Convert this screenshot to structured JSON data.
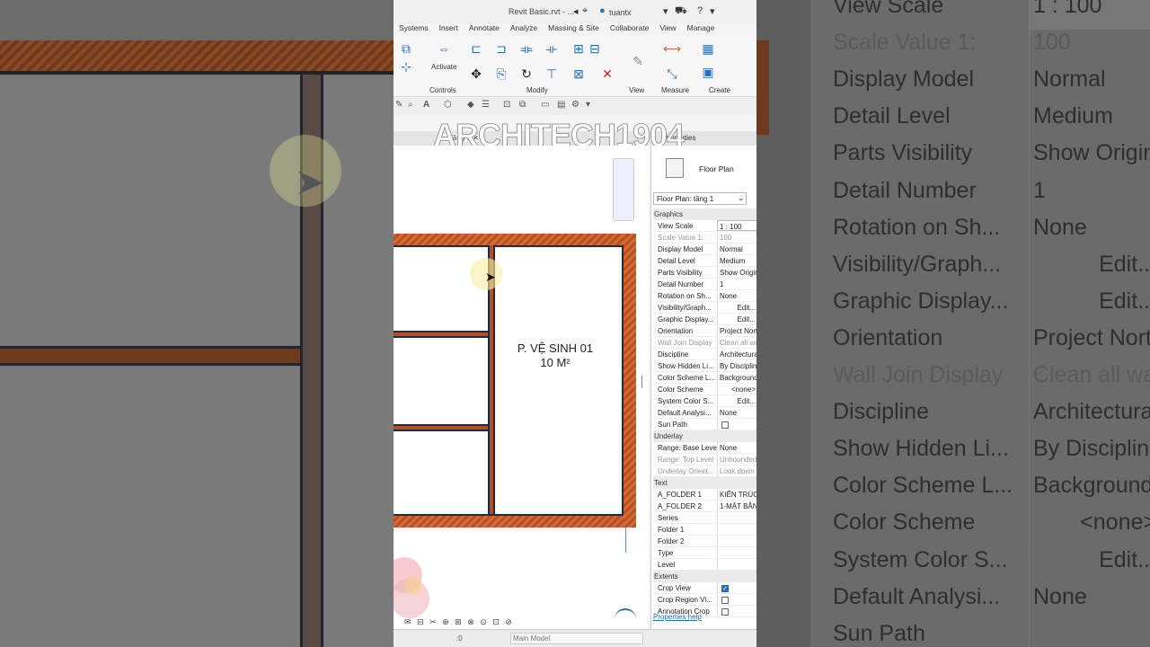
{
  "app": {
    "title": "Revit Basic.rvt - ...",
    "user": "tuantx",
    "tabs": [
      "Systems",
      "Insert",
      "Annotate",
      "Analyze",
      "Massing & Site",
      "Collaborate",
      "View",
      "Manage"
    ],
    "ribbon_groups": [
      "Controls",
      "Modify",
      "View",
      "Measure",
      "Create"
    ],
    "activate_label": "Activate",
    "view_tab": "Tầng 1",
    "properties_tab": "Properties",
    "watermark": "ARCHITECH1904"
  },
  "drawing": {
    "room_label_line1": "P. VỆ SINH 01",
    "room_label_line2": "10 M²"
  },
  "properties": {
    "type_name": "Floor Plan",
    "selector": "Floor Plan: tầng 1",
    "groups": [
      {
        "name": "Graphics",
        "rows": [
          {
            "k": "View Scale",
            "v": "1 : 100",
            "style": "box"
          },
          {
            "k": "Scale Value 1:",
            "v": "100",
            "style": "dim"
          },
          {
            "k": "Display Model",
            "v": "Normal"
          },
          {
            "k": "Detail Level",
            "v": "Medium"
          },
          {
            "k": "Parts Visibility",
            "v": "Show Original"
          },
          {
            "k": "Detail Number",
            "v": "1"
          },
          {
            "k": "Rotation on Sh...",
            "v": "None"
          },
          {
            "k": "Visibility/Graph...",
            "v": "Edit...",
            "style": "edit"
          },
          {
            "k": "Graphic Display...",
            "v": "Edit...",
            "style": "edit"
          },
          {
            "k": "Orientation",
            "v": "Project North"
          },
          {
            "k": "Wall Join Display",
            "v": "Clean all wall joins",
            "style": "dim"
          },
          {
            "k": "Discipline",
            "v": "Architectural"
          },
          {
            "k": "Show Hidden Li...",
            "v": "By Discipline"
          },
          {
            "k": "Color Scheme L...",
            "v": "Background"
          },
          {
            "k": "Color Scheme",
            "v": "<none>",
            "style": "edit"
          },
          {
            "k": "System Color S...",
            "v": "Edit...",
            "style": "edit"
          },
          {
            "k": "Default Analysi...",
            "v": "None"
          },
          {
            "k": "Sun Path",
            "v": "",
            "check": "off"
          }
        ]
      },
      {
        "name": "Underlay",
        "rows": [
          {
            "k": "Range: Base Level",
            "v": "None"
          },
          {
            "k": "Range: Top Level",
            "v": "Unbounded",
            "style": "dim"
          },
          {
            "k": "Underlay Orient...",
            "v": "Look down",
            "style": "dim"
          }
        ]
      },
      {
        "name": "Text",
        "rows": [
          {
            "k": "A_FOLDER 1",
            "v": "KIẾN TRÚC"
          },
          {
            "k": "A_FOLDER 2",
            "v": "1-MẶT BẰNG"
          },
          {
            "k": "Series",
            "v": ""
          },
          {
            "k": "Folder 1",
            "v": ""
          },
          {
            "k": "Folder 2",
            "v": ""
          },
          {
            "k": "Type",
            "v": ""
          },
          {
            "k": "Level",
            "v": ""
          }
        ]
      },
      {
        "name": "Extents",
        "rows": [
          {
            "k": "Crop View",
            "v": "",
            "check": "on"
          },
          {
            "k": "Crop Region Vi...",
            "v": "",
            "check": "off"
          },
          {
            "k": "Annotation Crop",
            "v": "",
            "check": "off"
          }
        ]
      }
    ],
    "help_link": "Properties help"
  },
  "status": {
    "count": ":0",
    "model": "Main Model"
  },
  "zoomed_rows": [
    {
      "k": "View Scale",
      "v": "1 : 100",
      "style": "box"
    },
    {
      "k": "Scale Value    1:",
      "v": "100",
      "style": "dim"
    },
    {
      "k": "Display Model",
      "v": "Normal"
    },
    {
      "k": "Detail Level",
      "v": "Medium"
    },
    {
      "k": "Parts Visibility",
      "v": "Show Original"
    },
    {
      "k": "Detail Number",
      "v": "1"
    },
    {
      "k": "Rotation on Sh...",
      "v": "None"
    },
    {
      "k": "Visibility/Graph...",
      "v": "Edit...",
      "style": "edit"
    },
    {
      "k": "Graphic Display...",
      "v": "Edit...",
      "style": "edit"
    },
    {
      "k": "Orientation",
      "v": "Project North"
    },
    {
      "k": "Wall Join Display",
      "v": "Clean all wall joins",
      "style": "dim"
    },
    {
      "k": "Discipline",
      "v": "Architectural"
    },
    {
      "k": "Show Hidden Li...",
      "v": "By Discipline"
    },
    {
      "k": "Color Scheme L...",
      "v": "Background"
    },
    {
      "k": "Color Scheme",
      "v": "<none>",
      "style": "edit"
    },
    {
      "k": "System Color S...",
      "v": "Edit...",
      "style": "edit"
    },
    {
      "k": "Default Analysi...",
      "v": "None"
    },
    {
      "k": "Sun Path",
      "v": ""
    }
  ],
  "colors": {
    "wall": "#d36a3a",
    "accent": "#2a6fb0"
  }
}
